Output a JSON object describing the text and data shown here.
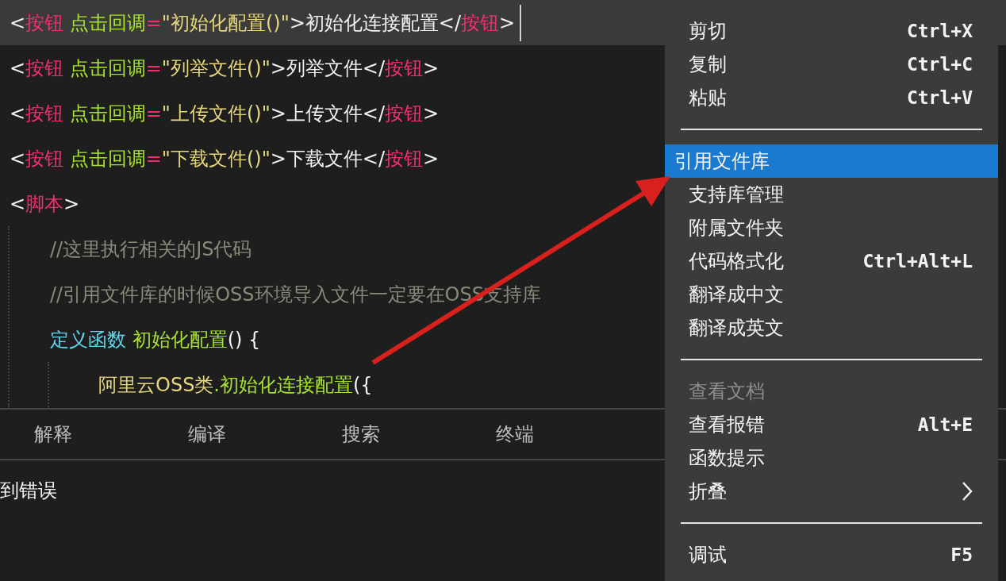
{
  "editor": {
    "lines": [
      {
        "selected": true,
        "tokens": [
          {
            "kind": "punct",
            "text": "<"
          },
          {
            "kind": "tag",
            "text": "按钮"
          },
          {
            "kind": "attr",
            "text": " 点击回调"
          },
          {
            "kind": "op",
            "text": "="
          },
          {
            "kind": "string",
            "text": "\"初始化配置()\""
          },
          {
            "kind": "punct",
            "text": ">初始化连接配置</"
          },
          {
            "kind": "tag",
            "text": "按钮"
          },
          {
            "kind": "punct",
            "text": ">"
          }
        ]
      },
      {
        "selected": false,
        "tokens": [
          {
            "kind": "punct",
            "text": "<"
          },
          {
            "kind": "tag",
            "text": "按钮"
          },
          {
            "kind": "attr",
            "text": " 点击回调"
          },
          {
            "kind": "op",
            "text": "="
          },
          {
            "kind": "string",
            "text": "\"列举文件()\""
          },
          {
            "kind": "punct",
            "text": ">列举文件</"
          },
          {
            "kind": "tag",
            "text": "按钮"
          },
          {
            "kind": "punct",
            "text": ">"
          }
        ]
      },
      {
        "selected": false,
        "tokens": [
          {
            "kind": "punct",
            "text": "<"
          },
          {
            "kind": "tag",
            "text": "按钮"
          },
          {
            "kind": "attr",
            "text": " 点击回调"
          },
          {
            "kind": "op",
            "text": "="
          },
          {
            "kind": "string",
            "text": "\"上传文件()\""
          },
          {
            "kind": "punct",
            "text": ">上传文件</"
          },
          {
            "kind": "tag",
            "text": "按钮"
          },
          {
            "kind": "punct",
            "text": ">"
          }
        ]
      },
      {
        "selected": false,
        "tokens": [
          {
            "kind": "punct",
            "text": "<"
          },
          {
            "kind": "tag",
            "text": "按钮"
          },
          {
            "kind": "attr",
            "text": " 点击回调"
          },
          {
            "kind": "op",
            "text": "="
          },
          {
            "kind": "string",
            "text": "\"下载文件()\""
          },
          {
            "kind": "punct",
            "text": ">下载文件</"
          },
          {
            "kind": "tag",
            "text": "按钮"
          },
          {
            "kind": "punct",
            "text": ">"
          }
        ]
      },
      {
        "selected": false,
        "tokens": [
          {
            "kind": "punct",
            "text": "<"
          },
          {
            "kind": "tag",
            "text": "脚本"
          },
          {
            "kind": "punct",
            "text": ">"
          }
        ],
        "children": [
          {
            "selected": false,
            "tokens": [
              {
                "kind": "comment",
                "text": "//这里执行相关的JS代码"
              }
            ]
          },
          {
            "selected": false,
            "tokens": [
              {
                "kind": "comment",
                "text": "//引用文件库的时候OSS环境导入文件一定要在OSS支持库"
              }
            ]
          },
          {
            "selected": false,
            "tokens": [
              {
                "kind": "keyword",
                "text": "定义函数"
              },
              {
                "kind": "func",
                "text": " 初始化配置"
              },
              {
                "kind": "punct",
                "text": "() {"
              }
            ],
            "children": [
              {
                "selected": false,
                "tokens": [
                  {
                    "kind": "class",
                    "text": "阿里云OSS类"
                  },
                  {
                    "kind": "func",
                    "text": ".初始化连接配置"
                  },
                  {
                    "kind": "punct",
                    "text": "({"
                  }
                ]
              }
            ]
          }
        ]
      }
    ]
  },
  "panel": {
    "tabs": [
      {
        "label": "解释",
        "selected": false
      },
      {
        "label": "编译",
        "selected": false
      },
      {
        "label": "搜索",
        "selected": false
      },
      {
        "label": "终端",
        "selected": false
      }
    ],
    "output": "到错误"
  },
  "context_menu": {
    "items": [
      {
        "kind": "item",
        "label": "剪切",
        "shortcut": "Ctrl+X",
        "selected": false,
        "disabled": false
      },
      {
        "kind": "item",
        "label": "复制",
        "shortcut": "Ctrl+C",
        "selected": false,
        "disabled": false
      },
      {
        "kind": "item",
        "label": "粘贴",
        "shortcut": "Ctrl+V",
        "selected": false,
        "disabled": false
      },
      {
        "kind": "separator"
      },
      {
        "kind": "item",
        "label": "引用文件库",
        "selected": true,
        "disabled": false
      },
      {
        "kind": "item",
        "label": "支持库管理",
        "selected": false,
        "disabled": false
      },
      {
        "kind": "item",
        "label": "附属文件夹",
        "selected": false,
        "disabled": false
      },
      {
        "kind": "item",
        "label": "代码格式化",
        "shortcut": "Ctrl+Alt+L",
        "selected": false,
        "disabled": false
      },
      {
        "kind": "item",
        "label": "翻译成中文",
        "selected": false,
        "disabled": false
      },
      {
        "kind": "item",
        "label": "翻译成英文",
        "selected": false,
        "disabled": false
      },
      {
        "kind": "separator"
      },
      {
        "kind": "item",
        "label": "查看文档",
        "selected": false,
        "disabled": true
      },
      {
        "kind": "item",
        "label": "查看报错",
        "shortcut": "Alt+E",
        "selected": false,
        "disabled": false
      },
      {
        "kind": "item",
        "label": "函数提示",
        "selected": false,
        "disabled": false
      },
      {
        "kind": "item",
        "label": "折叠",
        "selected": false,
        "disabled": false,
        "submenu": true
      },
      {
        "kind": "separator"
      },
      {
        "kind": "item",
        "label": "调试",
        "shortcut": "F5",
        "selected": false,
        "disabled": false
      }
    ]
  }
}
